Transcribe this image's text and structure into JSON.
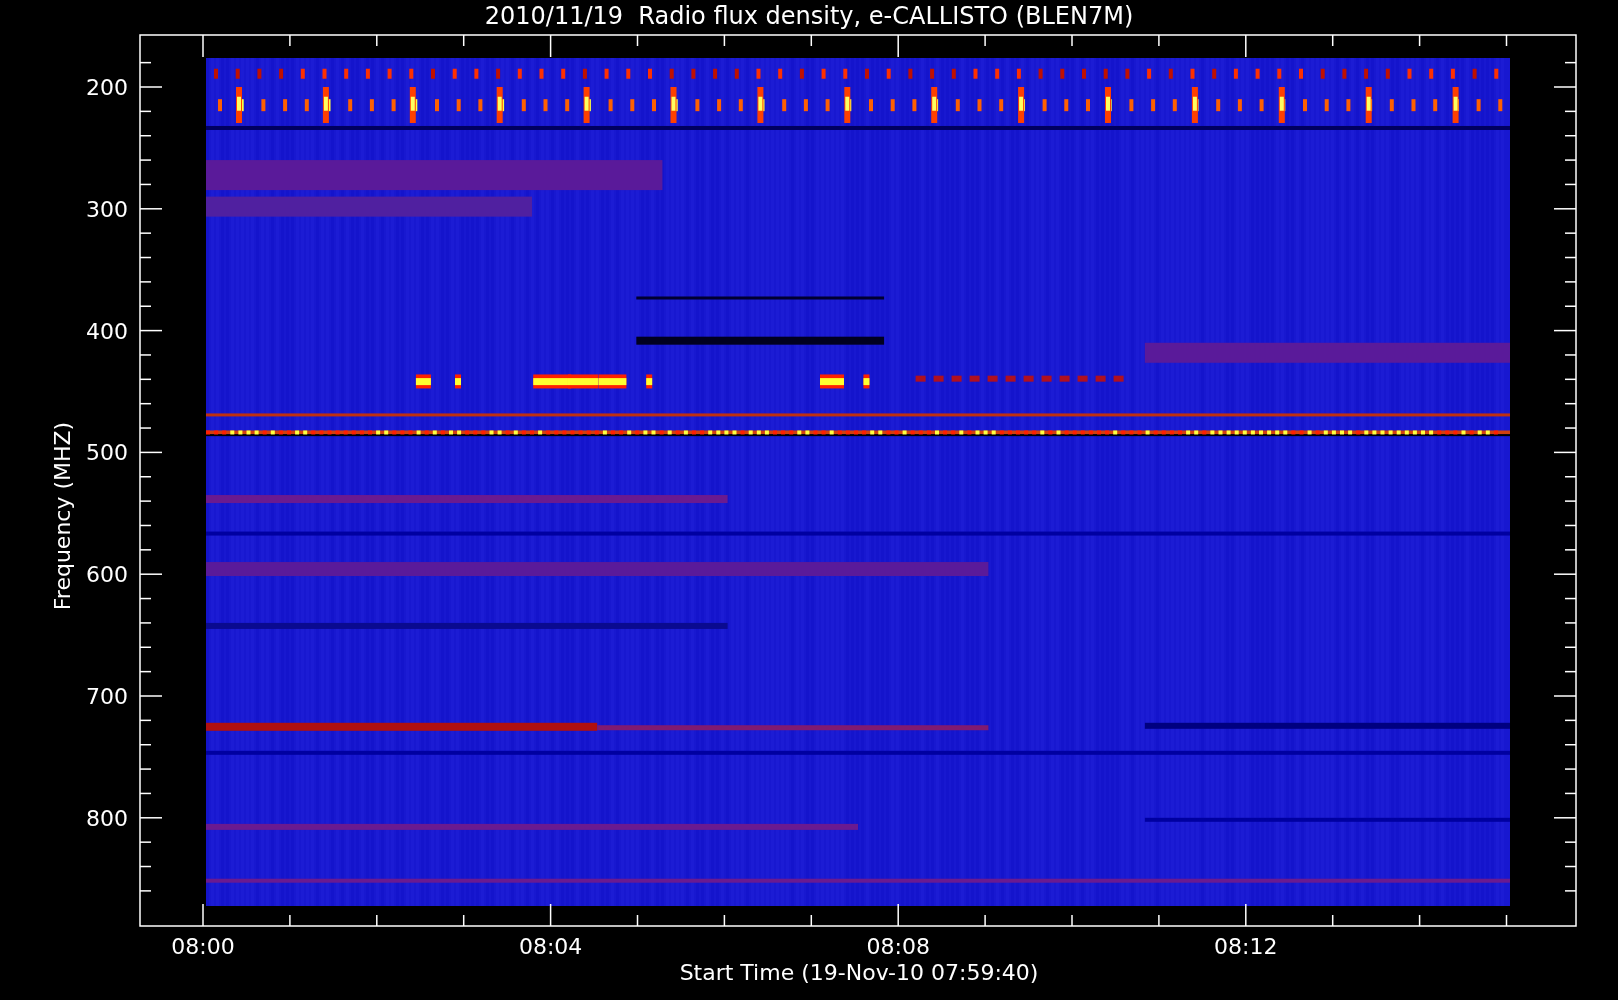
{
  "title": "2010/11/19  Radio flux density, e-CALLISTO (BLEN7M)",
  "plot": {
    "xlabel": "Start Time (19-Nov-10 07:59:40)",
    "ylabel": "Frequency (MHZ)",
    "xticks": [
      "08:00",
      "08:04",
      "08:08",
      "08:12"
    ],
    "yticks": [
      "200",
      "300",
      "400",
      "500",
      "600",
      "700",
      "800"
    ]
  }
}
